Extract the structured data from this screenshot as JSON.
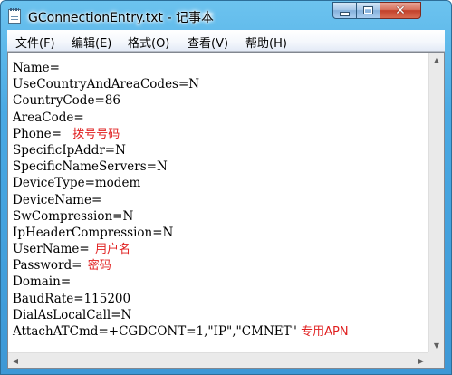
{
  "window": {
    "title": "GConnectionEntry.txt - 记事本",
    "app_icon": "notepad-icon",
    "controls": {
      "minimize_icon": "minimize-icon",
      "maximize_icon": "maximize-icon",
      "close_icon": "close-icon",
      "close_glyph": "✕"
    }
  },
  "menu": {
    "items": [
      {
        "label": "文件(F)"
      },
      {
        "label": "编辑(E)"
      },
      {
        "label": "格式(O)"
      },
      {
        "label": "查看(V)"
      },
      {
        "label": "帮助(H)"
      }
    ]
  },
  "editor": {
    "lines": [
      {
        "text": "Name=",
        "note": ""
      },
      {
        "text": "UseCountryAndAreaCodes=N",
        "note": ""
      },
      {
        "text": "CountryCode=86",
        "note": ""
      },
      {
        "text": "AreaCode=",
        "note": ""
      },
      {
        "text": "Phone= ",
        "note": "拨号号码"
      },
      {
        "text": "SpecificIpAddr=N",
        "note": ""
      },
      {
        "text": "SpecificNameServers=N",
        "note": ""
      },
      {
        "text": "DeviceType=modem",
        "note": ""
      },
      {
        "text": "DeviceName=",
        "note": ""
      },
      {
        "text": "SwCompression=N",
        "note": ""
      },
      {
        "text": "IpHeaderCompression=N",
        "note": ""
      },
      {
        "text": "UserName= ",
        "note": "用户名"
      },
      {
        "text": "Password= ",
        "note": "密码"
      },
      {
        "text": "Domain=",
        "note": ""
      },
      {
        "text": "BaudRate=115200",
        "note": ""
      },
      {
        "text": "DialAsLocalCall=N",
        "note": ""
      },
      {
        "text": "AttachATCmd=+CGDCONT=1,\"IP\",\"CMNET\" ",
        "note": "专用APN"
      }
    ],
    "note_color": "#e02020"
  },
  "scrollbars": {
    "up_arrow": "▲",
    "down_arrow": "▼",
    "left_arrow": "◀",
    "right_arrow": "▶"
  }
}
